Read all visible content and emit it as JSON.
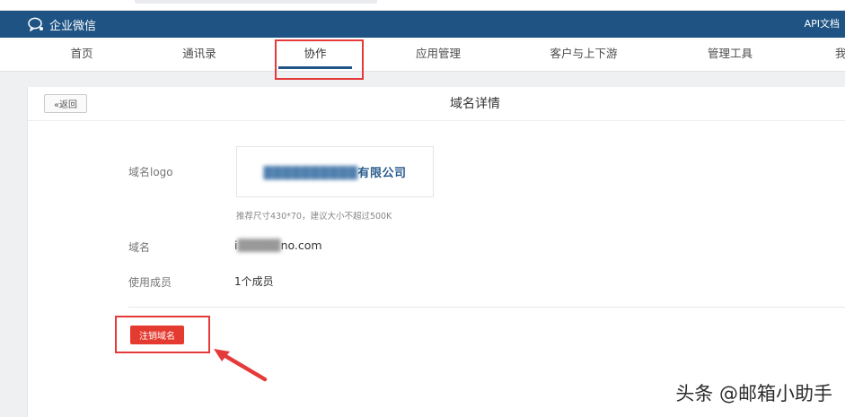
{
  "header": {
    "brand": "企业微信",
    "api_doc": "API文档",
    "colors": {
      "header_bg": "#1e5384",
      "highlight": "#e53a3a",
      "danger": "#e53a2f"
    }
  },
  "nav": {
    "items": [
      "首页",
      "通讯录",
      "协作",
      "应用管理",
      "客户与上下游",
      "管理工具",
      "我"
    ],
    "active": "协作"
  },
  "card": {
    "back": "«返回",
    "title": "域名详情",
    "fields": {
      "logo_label": "域名logo",
      "logo_blurred": "██████████",
      "logo_suffix": "有限公司",
      "logo_hint": "推荐尺寸430*70，建议大小不超过500K",
      "domain_label": "域名",
      "domain_prefix": "i",
      "domain_blurred": "█████",
      "domain_suffix": "no.com",
      "members_label": "使用成员",
      "members_value": "1个成员"
    },
    "cancel_button": "注销域名"
  },
  "watermark": "头条 @邮箱小助手",
  "icons": [
    "wecom-logo-icon",
    "arrow-annotation-icon"
  ]
}
